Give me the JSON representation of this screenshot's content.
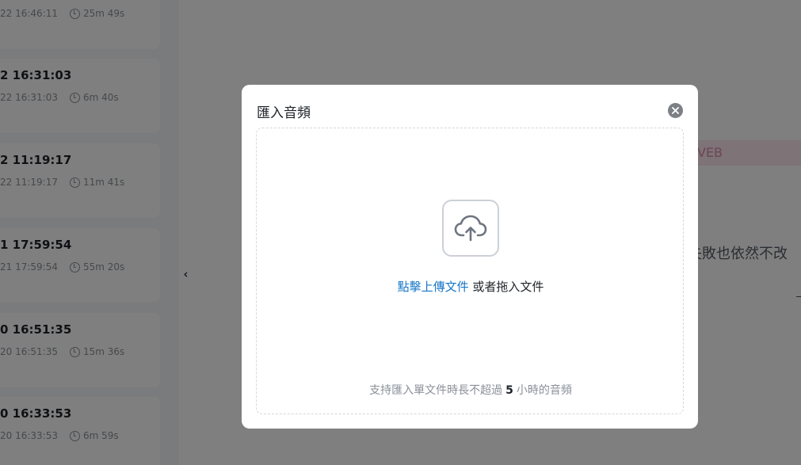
{
  "history": [
    {
      "title": "",
      "datetime": "22 16:46:11",
      "duration": "25m 49s"
    },
    {
      "title": "2 16:31:03",
      "datetime": "22 16:31:03",
      "duration": "6m 40s"
    },
    {
      "title": "2 11:19:17",
      "datetime": "22 11:19:17",
      "duration": "11m 41s"
    },
    {
      "title": "1 17:59:54",
      "datetime": "21 17:59:54",
      "duration": "55m 20s"
    },
    {
      "title": "0 16:51:35",
      "datetime": "20 16:51:35",
      "duration": "15m 36s"
    },
    {
      "title": "0 16:33:53",
      "datetime": "20 16:33:53",
      "duration": "6m 59s"
    }
  ],
  "sidebar_toggle": "‹",
  "background": {
    "tag": "VEB",
    "text": "失敗也依然不改"
  },
  "modal": {
    "title": "匯入音頻",
    "upload_link": "點擊上傳文件",
    "upload_text": " 或者拖入文件",
    "hint_prefix": "支持匯入單文件時長不超過",
    "hint_number": "5",
    "hint_suffix": "小時的音頻"
  },
  "icons": {
    "close": "close-circle-icon",
    "upload": "cloud-upload-icon",
    "clock": "clock-icon"
  },
  "colors": {
    "link": "#1677c8",
    "overlay": "rgba(0,0,0,0.5)"
  }
}
